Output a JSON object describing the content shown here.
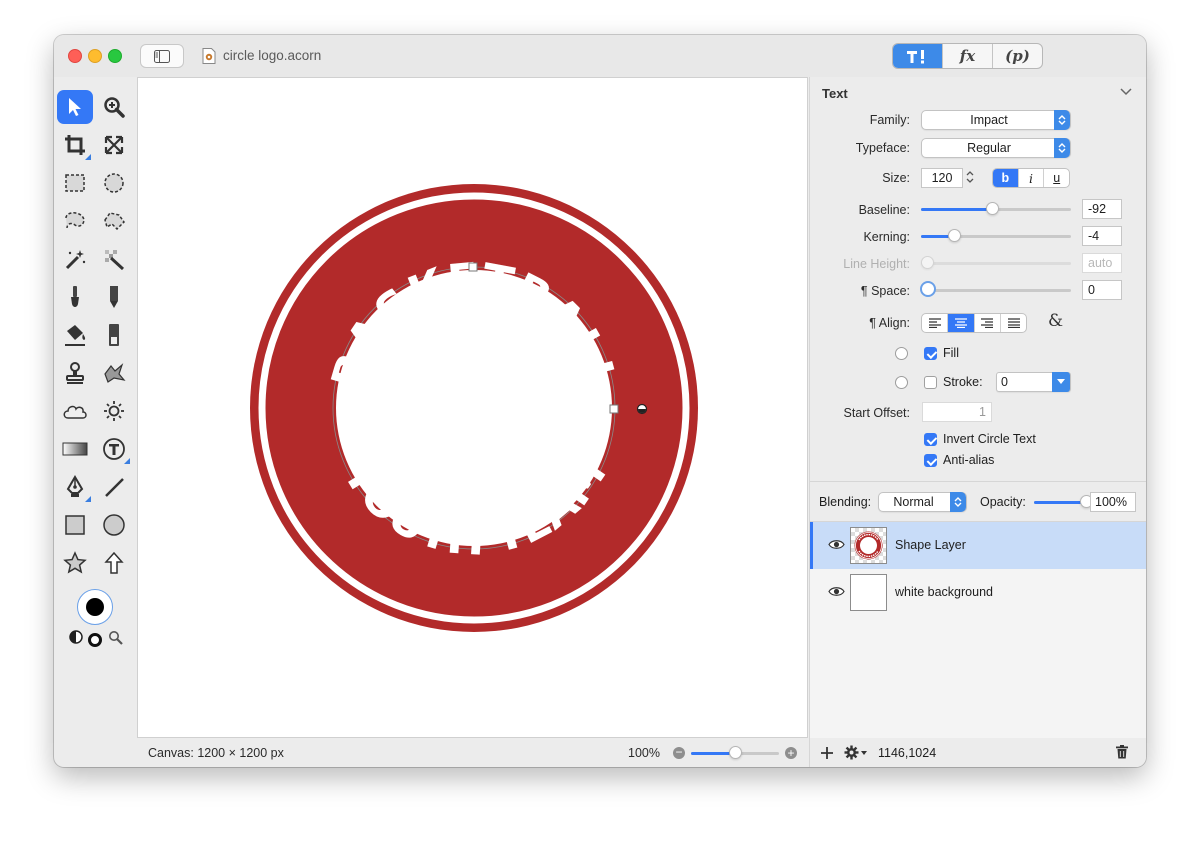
{
  "window": {
    "document_title": "circle logo.acorn",
    "toolbar_segments": [
      {
        "name": "tools-palette",
        "glyph": "T!"
      },
      {
        "name": "effects",
        "glyph": "fx"
      },
      {
        "name": "presets",
        "glyph": "(p)"
      }
    ]
  },
  "tool_icons": [
    "select-arrow-icon",
    "zoom-icon",
    "crop-icon",
    "transform-icon",
    "rect-marquee-icon",
    "ellipse-marquee-icon",
    "lasso-icon",
    "polygon-lasso-icon",
    "magic-wand-icon",
    "color-select-icon",
    "brush-icon",
    "pencil-icon",
    "paint-bucket-icon",
    "gradient-eraser-icon",
    "clone-stamp-icon",
    "retouch-icon",
    "cloud-icon",
    "sun-icon",
    "gradient-icon",
    "text-tool-icon",
    "pen-tool-icon",
    "line-icon",
    "rectangle-shape-icon",
    "oval-shape-icon",
    "star-icon",
    "arrow-shape-icon"
  ],
  "artwork": {
    "top_text": "BASKETBALL",
    "bottom_text": "YOUTH TEAM",
    "color": "#b22a2a"
  },
  "status": {
    "canvas_size": "Canvas: 1200 × 1200 px",
    "zoom": "100%",
    "zoom_fraction": 0.5,
    "coords": "1146,1024"
  },
  "inspector": {
    "section_title": "Text",
    "family_label": "Family:",
    "family_value": "Impact",
    "typeface_label": "Typeface:",
    "typeface_value": "Regular",
    "size_label": "Size:",
    "size_value": "120",
    "style_buttons": [
      "b",
      "i",
      "u"
    ],
    "baseline_label": "Baseline:",
    "baseline_value": "-92",
    "baseline_fraction": 0.47,
    "kerning_label": "Kerning:",
    "kerning_value": "-4",
    "kerning_fraction": 0.22,
    "line_height_label": "Line Height:",
    "line_height_value": "auto",
    "space_label": "¶ Space:",
    "space_value": "0",
    "align_label": "¶ Align:",
    "fill_label": "Fill",
    "stroke_label": "Stroke:",
    "stroke_value": "0",
    "start_offset_label": "Start Offset:",
    "start_offset_value": "1",
    "invert_label": "Invert Circle Text",
    "antialias_label": "Anti-alias"
  },
  "layers_panel": {
    "blending_label": "Blending:",
    "blending_value": "Normal",
    "opacity_label": "Opacity:",
    "opacity_value": "100%",
    "opacity_fraction": 1.0,
    "layers": [
      {
        "name": "Shape Layer",
        "selected": true
      },
      {
        "name": "white background",
        "selected": false
      }
    ]
  },
  "colors": {
    "accent": "#3478f6",
    "logo_red": "#b22a2a",
    "selection_row": "#c8dcf8"
  }
}
